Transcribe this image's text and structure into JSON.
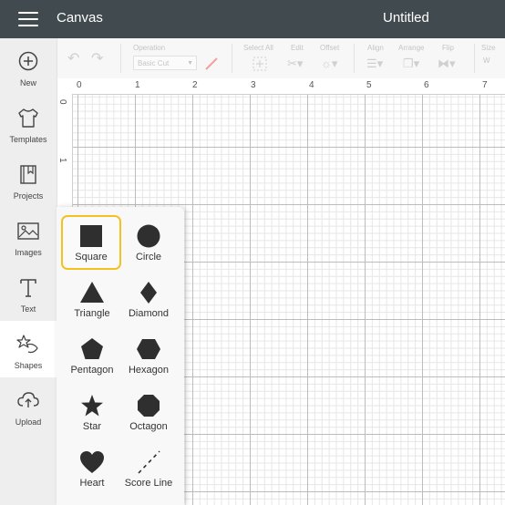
{
  "header": {
    "menu_icon": "hamburger-icon",
    "app_title": "Canvas",
    "document_title": "Untitled"
  },
  "toolbar": {
    "operation_label": "Operation",
    "operation_value": "Basic Cut",
    "select_all_label": "Select All",
    "edit_label": "Edit",
    "offset_label": "Offset",
    "align_label": "Align",
    "arrange_label": "Arrange",
    "flip_label": "Flip",
    "size_label": "Size",
    "size_w_label": "W"
  },
  "sidebar": {
    "items": [
      {
        "label": "New",
        "icon": "plus-circle-icon"
      },
      {
        "label": "Templates",
        "icon": "tshirt-icon"
      },
      {
        "label": "Projects",
        "icon": "bookmark-book-icon"
      },
      {
        "label": "Images",
        "icon": "image-icon"
      },
      {
        "label": "Text",
        "icon": "text-icon"
      },
      {
        "label": "Shapes",
        "icon": "shapes-icon"
      },
      {
        "label": "Upload",
        "icon": "cloud-upload-icon"
      }
    ],
    "active": "Shapes"
  },
  "rulers": {
    "top": [
      "0",
      "1",
      "2",
      "3",
      "4",
      "5",
      "6",
      "7"
    ],
    "left": [
      "0",
      "1"
    ]
  },
  "shapes_panel": {
    "selected": "Square",
    "items": [
      {
        "label": "Square",
        "icon": "square-icon"
      },
      {
        "label": "Circle",
        "icon": "circle-icon"
      },
      {
        "label": "Triangle",
        "icon": "triangle-icon"
      },
      {
        "label": "Diamond",
        "icon": "diamond-icon"
      },
      {
        "label": "Pentagon",
        "icon": "pentagon-icon"
      },
      {
        "label": "Hexagon",
        "icon": "hexagon-icon"
      },
      {
        "label": "Star",
        "icon": "star-icon"
      },
      {
        "label": "Octagon",
        "icon": "octagon-icon"
      },
      {
        "label": "Heart",
        "icon": "heart-icon"
      },
      {
        "label": "Score Line",
        "icon": "score-line-icon"
      }
    ]
  },
  "colors": {
    "topbar": "#414a4f",
    "selection": "#f4c220",
    "shape_fill": "#2f2f2f"
  }
}
